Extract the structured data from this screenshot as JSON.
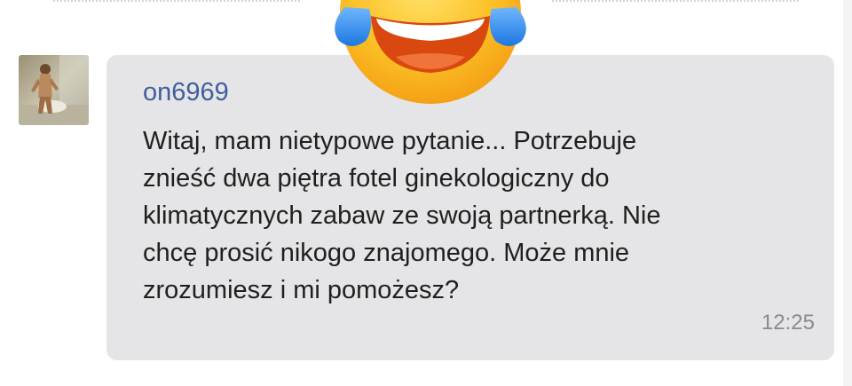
{
  "message": {
    "sender": "on6969",
    "lines": [
      "Witaj, mam nietypowe pytanie... Potrzebuje",
      "znieść dwa piętra fotel ginekologiczny do",
      "klimatycznych zabaw ze swoją partnerką. Nie",
      "chcę prosić nikogo znajomego. Może mnie",
      "zrozumiesz i mi pomożesz?"
    ],
    "time": "12:25"
  },
  "overlay": {
    "emoji": "face-with-tears-of-joy-icon"
  },
  "colors": {
    "bubble": "#e5e5e7",
    "username": "#3f5f9b",
    "text": "#1f1f1f",
    "timestamp": "#8a8a8a"
  }
}
